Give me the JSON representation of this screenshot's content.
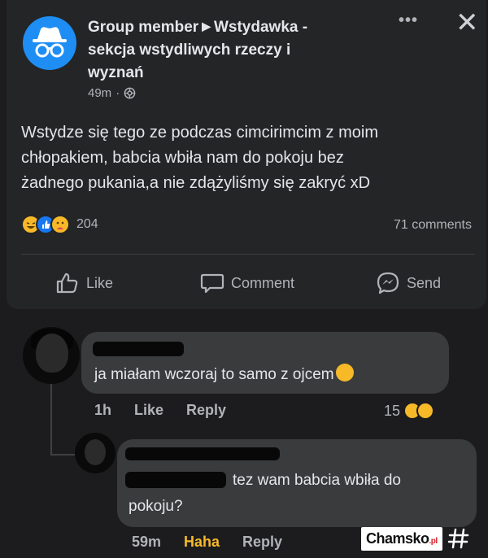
{
  "post": {
    "author": "Group member",
    "group_name": "Wstydawka - sekcja wstydliwych rzeczy i wyznań",
    "group_line1": "Wstydawka -",
    "group_line2": "sekcja wstydliwych rzeczy i",
    "group_line3": "wyznań",
    "time": "49m",
    "separator": "·",
    "more_icon": "more-horizontal-icon",
    "close_icon": "close-icon",
    "text_line1": "Wstydze się tego ze podczas cimcirimcim z moim",
    "text_line2": "chłopakiem, babcia wbiła nam do pokoju bez",
    "text_line3": "żadnego pukania,a nie zdążyliśmy się zakryć xD",
    "reaction_count": "204",
    "reactions": [
      "haha",
      "like",
      "care"
    ],
    "comments_count": "71 comments"
  },
  "actions": {
    "like": "Like",
    "comment": "Comment",
    "send": "Send"
  },
  "comments": [
    {
      "text": "ja miałam wczoraj to samo z ojcem",
      "emoji": "care",
      "time": "1h",
      "like_label": "Like",
      "reply_label": "Reply",
      "reaction_count": "15",
      "reactions": [
        "care",
        "sad"
      ]
    },
    {
      "text_line1": "tez wam babcia wbiła do",
      "text_line2": "pokoju?",
      "time": "59m",
      "like_label": "Haha",
      "reply_label": "Reply"
    }
  ],
  "watermark": {
    "brand": "Chamsko",
    "tld": ".pl",
    "icon": "hash-icon"
  },
  "colors": {
    "background": "#1c1c1e",
    "card": "#242526",
    "bubble": "#3a3b3c",
    "accent_blue": "#1877f2",
    "haha_yellow": "#f7b928",
    "muted_text": "#b0b3b8"
  }
}
